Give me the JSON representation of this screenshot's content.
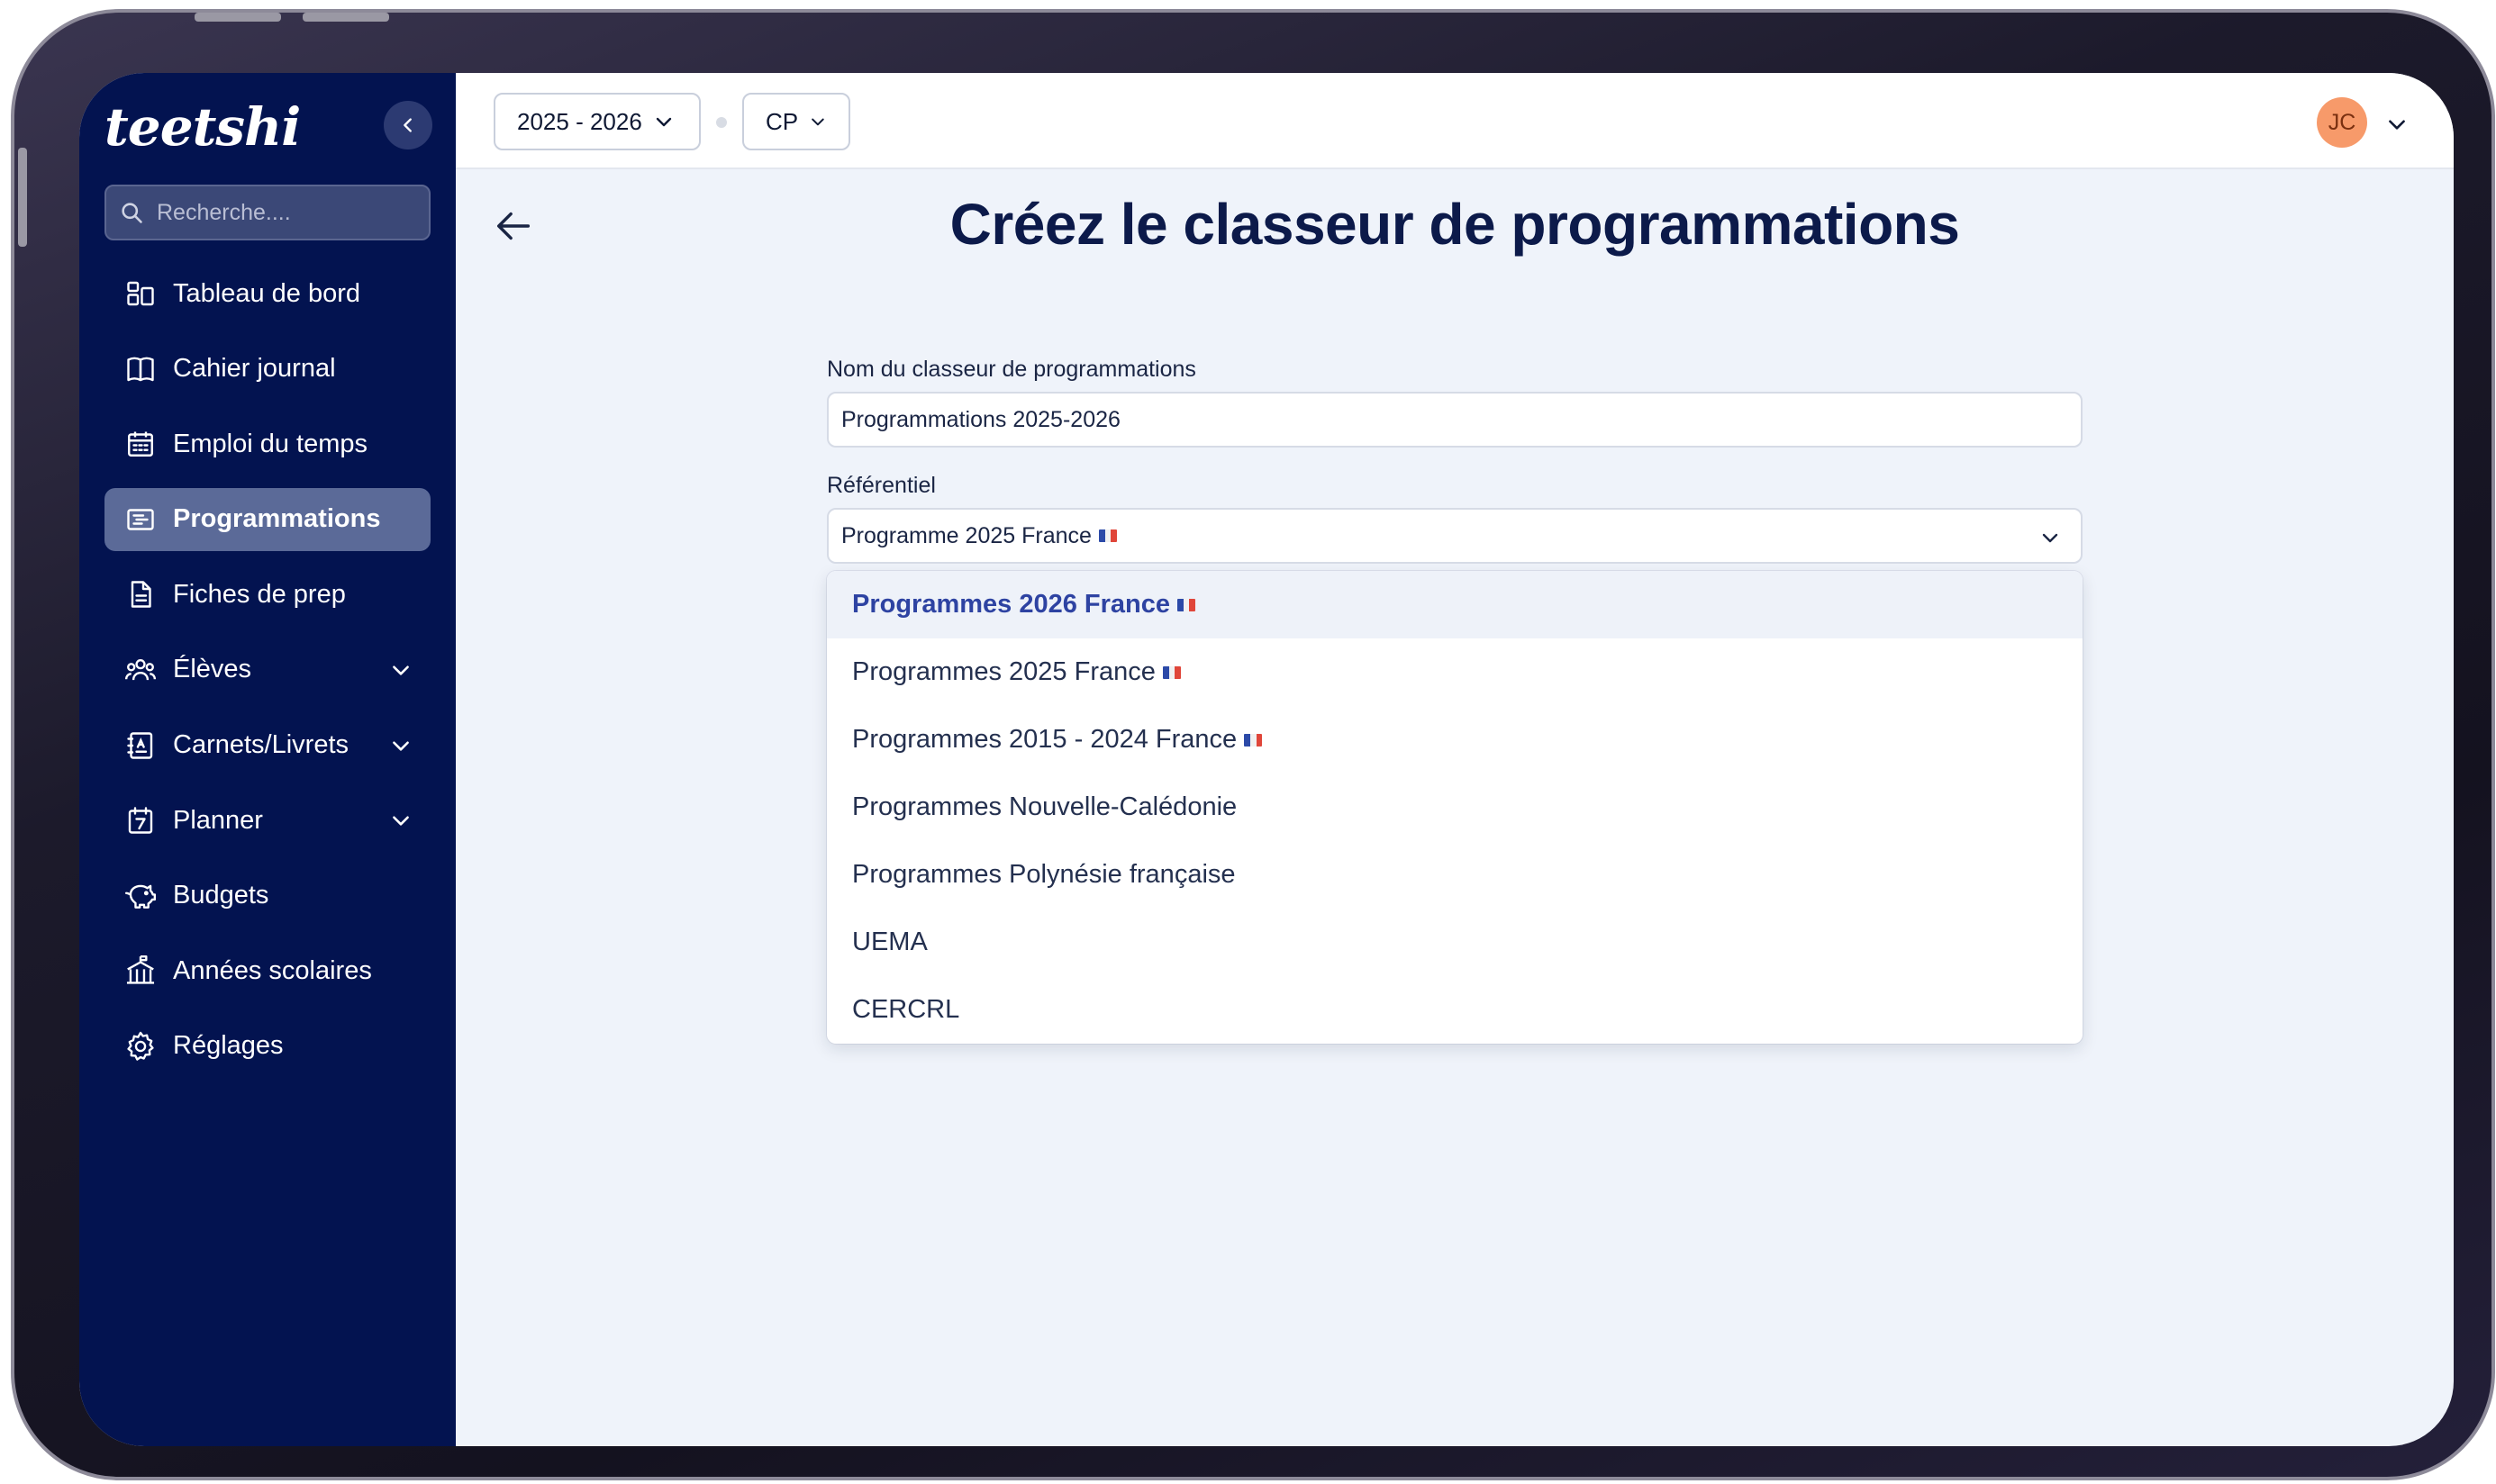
{
  "app": {
    "logo_text": "teetshi"
  },
  "sidebar": {
    "search_placeholder": "Recherche....",
    "items": [
      {
        "label": "Tableau de bord",
        "icon": "dashboard-icon",
        "active": false,
        "expandable": false
      },
      {
        "label": "Cahier journal",
        "icon": "book-icon",
        "active": false,
        "expandable": false
      },
      {
        "label": "Emploi du temps",
        "icon": "calendar-icon",
        "active": false,
        "expandable": false
      },
      {
        "label": "Programmations",
        "icon": "programmations-icon",
        "active": true,
        "expandable": false
      },
      {
        "label": "Fiches de prep",
        "icon": "document-icon",
        "active": false,
        "expandable": false
      },
      {
        "label": "Élèves",
        "icon": "students-icon",
        "active": false,
        "expandable": true
      },
      {
        "label": "Carnets/Livrets",
        "icon": "notebook-icon",
        "active": false,
        "expandable": true
      },
      {
        "label": "Planner",
        "icon": "planner-icon",
        "active": false,
        "expandable": true
      },
      {
        "label": "Budgets",
        "icon": "piggy-bank-icon",
        "active": false,
        "expandable": false
      },
      {
        "label": "Années scolaires",
        "icon": "school-icon",
        "active": false,
        "expandable": false
      },
      {
        "label": "Réglages",
        "icon": "gear-icon",
        "active": false,
        "expandable": false
      }
    ]
  },
  "topbar": {
    "year_select": "2025 - 2026",
    "class_select": "CP",
    "user_initials": "JC"
  },
  "page": {
    "title": "Créez le classeur de programmations"
  },
  "form": {
    "name_label": "Nom du classeur de programmations",
    "name_value": "Programmations 2025-2026",
    "referentiel_label": "Référentiel",
    "referentiel_value": "Programme 2025 France"
  },
  "dropdown": {
    "options": [
      {
        "label": "Programmes 2026 France",
        "flag": true,
        "highlighted": true
      },
      {
        "label": "Programmes 2025 France",
        "flag": true,
        "highlighted": false
      },
      {
        "label": "Programmes 2015 - 2024 France",
        "flag": true,
        "highlighted": false
      },
      {
        "label": "Programmes Nouvelle-Calédonie",
        "flag": false,
        "highlighted": false
      },
      {
        "label": "Programmes Polynésie française",
        "flag": false,
        "highlighted": false
      },
      {
        "label": "UEMA",
        "flag": false,
        "highlighted": false
      },
      {
        "label": "CERCRL",
        "flag": false,
        "highlighted": false
      }
    ]
  },
  "colors": {
    "sidebar_bg": "#031350",
    "active_item_bg": "#5b6a98",
    "title_color": "#0c1a4a",
    "highlight_text": "#2e43a2",
    "avatar_bg": "#f79a6a"
  }
}
